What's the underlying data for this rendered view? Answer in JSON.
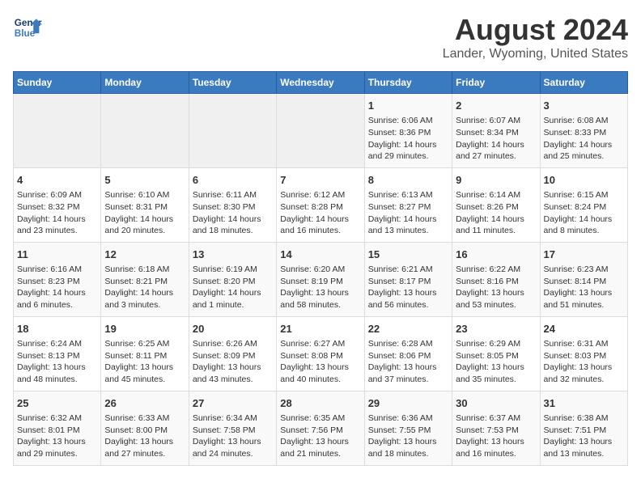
{
  "header": {
    "logo_line1": "General",
    "logo_line2": "Blue",
    "main_title": "August 2024",
    "subtitle": "Lander, Wyoming, United States"
  },
  "days_of_week": [
    "Sunday",
    "Monday",
    "Tuesday",
    "Wednesday",
    "Thursday",
    "Friday",
    "Saturday"
  ],
  "weeks": [
    [
      {
        "day": "",
        "info": ""
      },
      {
        "day": "",
        "info": ""
      },
      {
        "day": "",
        "info": ""
      },
      {
        "day": "",
        "info": ""
      },
      {
        "day": "1",
        "info": "Sunrise: 6:06 AM\nSunset: 8:36 PM\nDaylight: 14 hours and 29 minutes."
      },
      {
        "day": "2",
        "info": "Sunrise: 6:07 AM\nSunset: 8:34 PM\nDaylight: 14 hours and 27 minutes."
      },
      {
        "day": "3",
        "info": "Sunrise: 6:08 AM\nSunset: 8:33 PM\nDaylight: 14 hours and 25 minutes."
      }
    ],
    [
      {
        "day": "4",
        "info": "Sunrise: 6:09 AM\nSunset: 8:32 PM\nDaylight: 14 hours and 23 minutes."
      },
      {
        "day": "5",
        "info": "Sunrise: 6:10 AM\nSunset: 8:31 PM\nDaylight: 14 hours and 20 minutes."
      },
      {
        "day": "6",
        "info": "Sunrise: 6:11 AM\nSunset: 8:30 PM\nDaylight: 14 hours and 18 minutes."
      },
      {
        "day": "7",
        "info": "Sunrise: 6:12 AM\nSunset: 8:28 PM\nDaylight: 14 hours and 16 minutes."
      },
      {
        "day": "8",
        "info": "Sunrise: 6:13 AM\nSunset: 8:27 PM\nDaylight: 14 hours and 13 minutes."
      },
      {
        "day": "9",
        "info": "Sunrise: 6:14 AM\nSunset: 8:26 PM\nDaylight: 14 hours and 11 minutes."
      },
      {
        "day": "10",
        "info": "Sunrise: 6:15 AM\nSunset: 8:24 PM\nDaylight: 14 hours and 8 minutes."
      }
    ],
    [
      {
        "day": "11",
        "info": "Sunrise: 6:16 AM\nSunset: 8:23 PM\nDaylight: 14 hours and 6 minutes."
      },
      {
        "day": "12",
        "info": "Sunrise: 6:18 AM\nSunset: 8:21 PM\nDaylight: 14 hours and 3 minutes."
      },
      {
        "day": "13",
        "info": "Sunrise: 6:19 AM\nSunset: 8:20 PM\nDaylight: 14 hours and 1 minute."
      },
      {
        "day": "14",
        "info": "Sunrise: 6:20 AM\nSunset: 8:19 PM\nDaylight: 13 hours and 58 minutes."
      },
      {
        "day": "15",
        "info": "Sunrise: 6:21 AM\nSunset: 8:17 PM\nDaylight: 13 hours and 56 minutes."
      },
      {
        "day": "16",
        "info": "Sunrise: 6:22 AM\nSunset: 8:16 PM\nDaylight: 13 hours and 53 minutes."
      },
      {
        "day": "17",
        "info": "Sunrise: 6:23 AM\nSunset: 8:14 PM\nDaylight: 13 hours and 51 minutes."
      }
    ],
    [
      {
        "day": "18",
        "info": "Sunrise: 6:24 AM\nSunset: 8:13 PM\nDaylight: 13 hours and 48 minutes."
      },
      {
        "day": "19",
        "info": "Sunrise: 6:25 AM\nSunset: 8:11 PM\nDaylight: 13 hours and 45 minutes."
      },
      {
        "day": "20",
        "info": "Sunrise: 6:26 AM\nSunset: 8:09 PM\nDaylight: 13 hours and 43 minutes."
      },
      {
        "day": "21",
        "info": "Sunrise: 6:27 AM\nSunset: 8:08 PM\nDaylight: 13 hours and 40 minutes."
      },
      {
        "day": "22",
        "info": "Sunrise: 6:28 AM\nSunset: 8:06 PM\nDaylight: 13 hours and 37 minutes."
      },
      {
        "day": "23",
        "info": "Sunrise: 6:29 AM\nSunset: 8:05 PM\nDaylight: 13 hours and 35 minutes."
      },
      {
        "day": "24",
        "info": "Sunrise: 6:31 AM\nSunset: 8:03 PM\nDaylight: 13 hours and 32 minutes."
      }
    ],
    [
      {
        "day": "25",
        "info": "Sunrise: 6:32 AM\nSunset: 8:01 PM\nDaylight: 13 hours and 29 minutes."
      },
      {
        "day": "26",
        "info": "Sunrise: 6:33 AM\nSunset: 8:00 PM\nDaylight: 13 hours and 27 minutes."
      },
      {
        "day": "27",
        "info": "Sunrise: 6:34 AM\nSunset: 7:58 PM\nDaylight: 13 hours and 24 minutes."
      },
      {
        "day": "28",
        "info": "Sunrise: 6:35 AM\nSunset: 7:56 PM\nDaylight: 13 hours and 21 minutes."
      },
      {
        "day": "29",
        "info": "Sunrise: 6:36 AM\nSunset: 7:55 PM\nDaylight: 13 hours and 18 minutes."
      },
      {
        "day": "30",
        "info": "Sunrise: 6:37 AM\nSunset: 7:53 PM\nDaylight: 13 hours and 16 minutes."
      },
      {
        "day": "31",
        "info": "Sunrise: 6:38 AM\nSunset: 7:51 PM\nDaylight: 13 hours and 13 minutes."
      }
    ]
  ]
}
